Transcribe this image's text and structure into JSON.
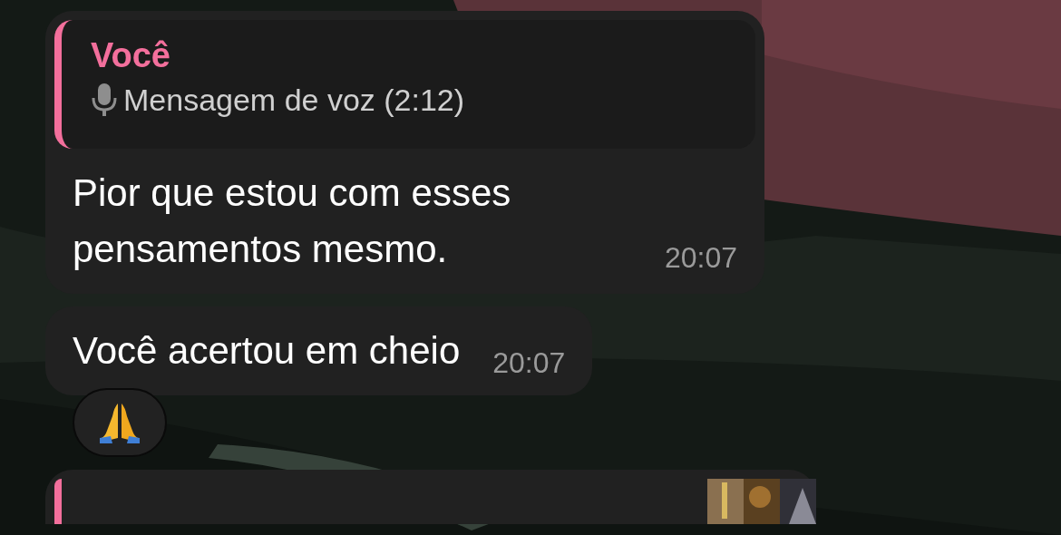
{
  "messages": [
    {
      "kind": "reply",
      "quote": {
        "author": "Você",
        "text": "Mensagem de voz (2:12)",
        "color": "#f36f9c"
      },
      "text": "Pior que estou com esses pensamentos mesmo.",
      "time": "20:07"
    },
    {
      "kind": "text",
      "text": "Você acertou em cheio",
      "time": "20:07",
      "reaction": true
    },
    {
      "kind": "cut",
      "quote": {
        "color": "#f36f9c"
      }
    }
  ]
}
